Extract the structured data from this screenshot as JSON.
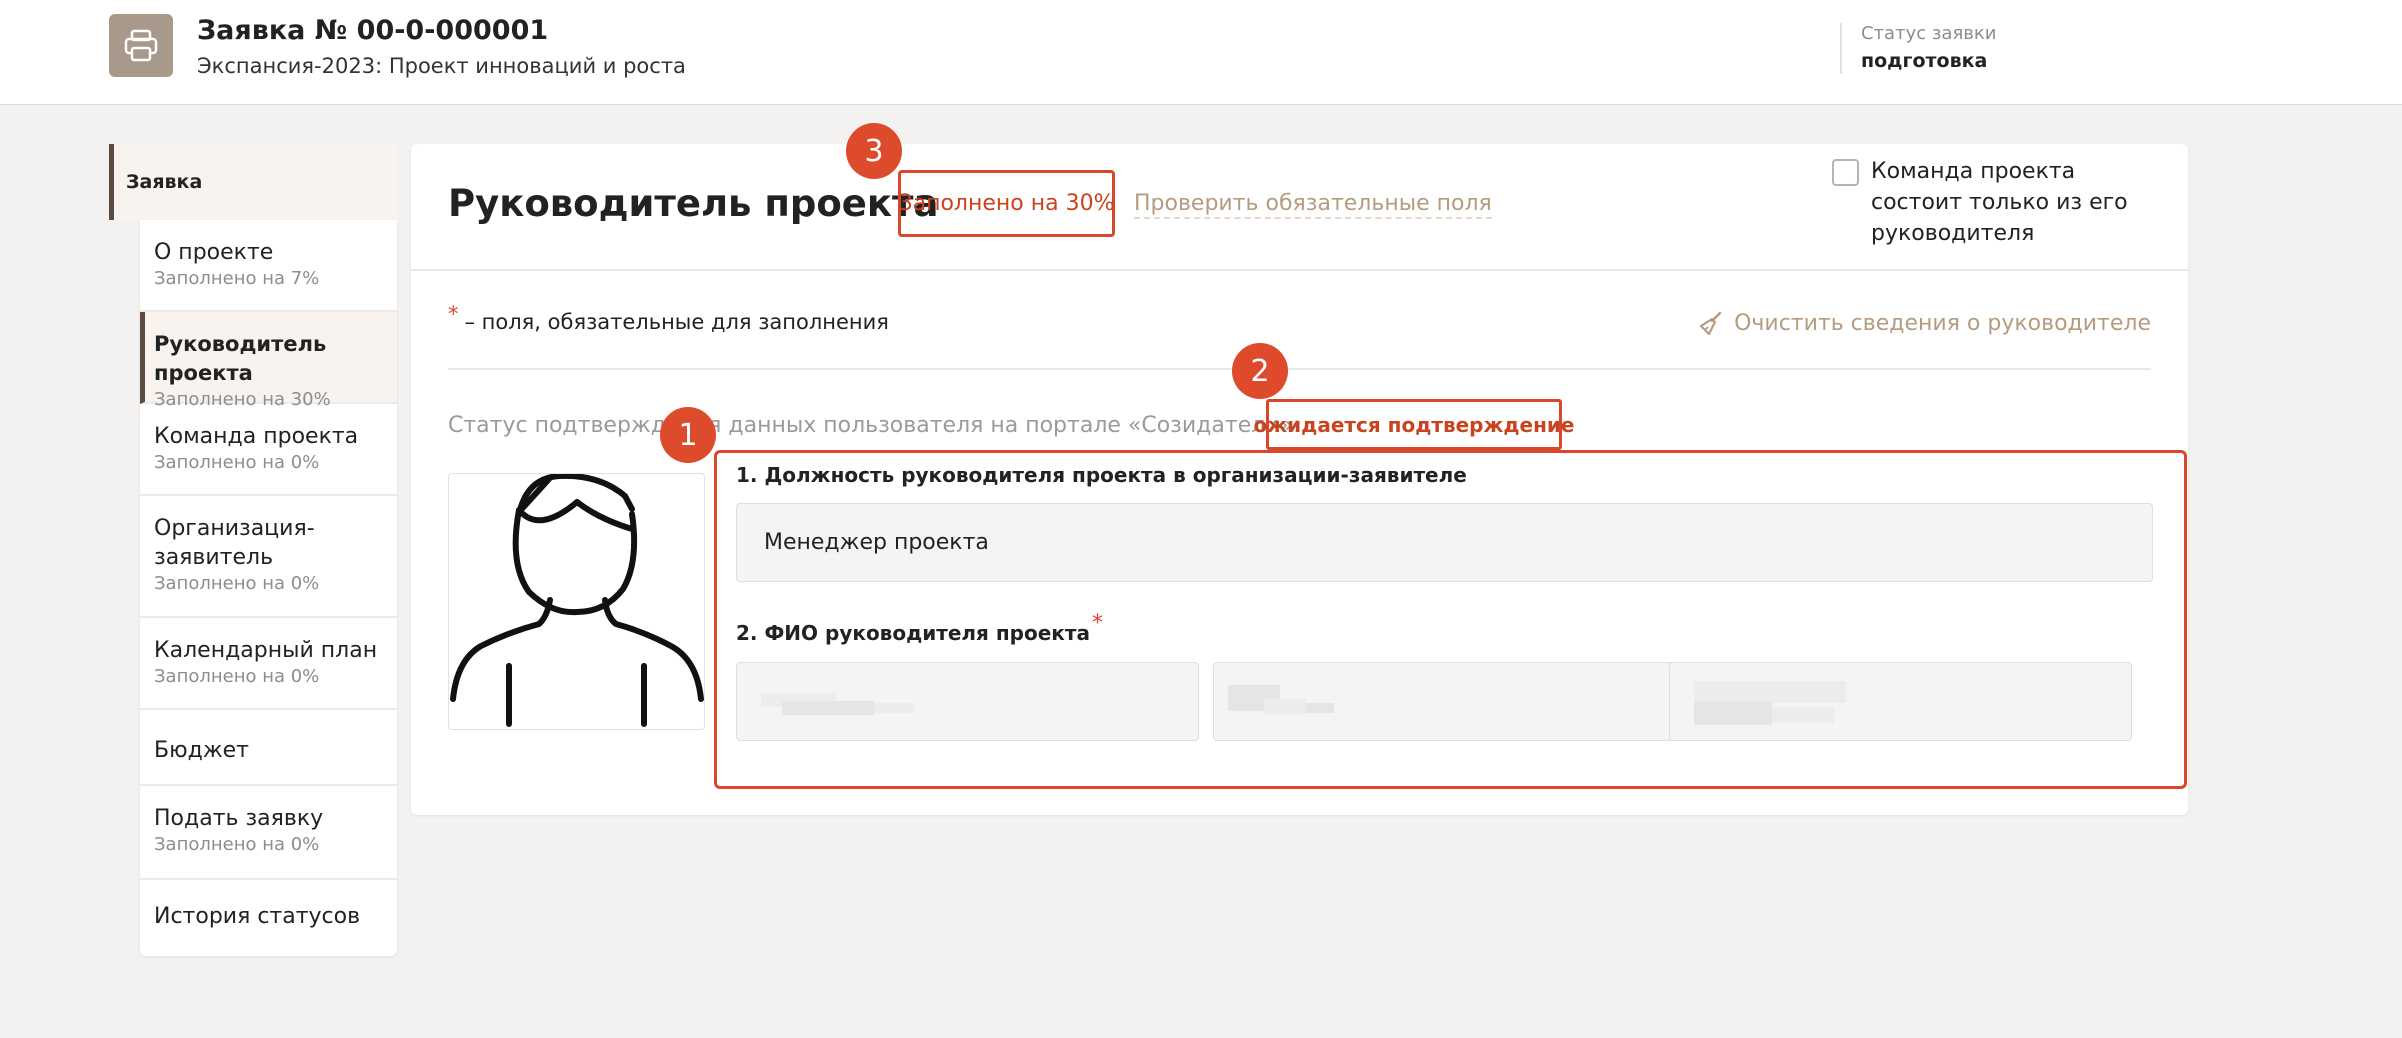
{
  "header": {
    "icon": "printer-icon",
    "title": "Заявка № 00-0-000001",
    "subtitle": "Экспансия-2023: Проект инноваций и роста",
    "status_label": "Статус заявки",
    "status_value": "подготовка"
  },
  "sidebar": {
    "parent": "Заявка",
    "items": [
      {
        "label": "О проекте",
        "sub": "Заполнено на 7%"
      },
      {
        "label": "Руководитель проекта",
        "sub": "Заполнено на 30%"
      },
      {
        "label": "Команда проекта",
        "sub": "Заполнено на 0%"
      },
      {
        "label": "Организация-заявитель",
        "sub": "Заполнено на 0%"
      },
      {
        "label": "Календарный план",
        "sub": "Заполнено на 0%"
      },
      {
        "label": "Бюджет",
        "sub": ""
      },
      {
        "label": "Подать заявку",
        "sub": "Заполнено на 0%"
      },
      {
        "label": "История статусов",
        "sub": ""
      }
    ]
  },
  "main": {
    "title": "Руководитель проекта",
    "fill_status": "Заполнено на 30%",
    "check_link": "Проверить обязательные поля",
    "team_checkbox_label": "Команда проекта состоит только из его руководителя",
    "required_star": "*",
    "required_note": "– поля, обязательные для заполнения",
    "clear_button": "Очистить сведения о руководителе",
    "confirm_label": "Статус подтверждения данных пользователя на портале «Созидатели»:",
    "confirm_status": "ожидается подтверждение",
    "field1_label": "1. Должность руководителя проекта в организации-заявителе",
    "field1_value": "Менеджер проекта",
    "field2_label": "2. ФИО руководителя проекта",
    "field2_star": "*"
  },
  "badges": [
    "1",
    "2",
    "3"
  ],
  "colors": {
    "accent": "#d9472b",
    "brown": "#5c4b3e",
    "link": "#b59c7f",
    "icon_bg": "#a8998a"
  }
}
